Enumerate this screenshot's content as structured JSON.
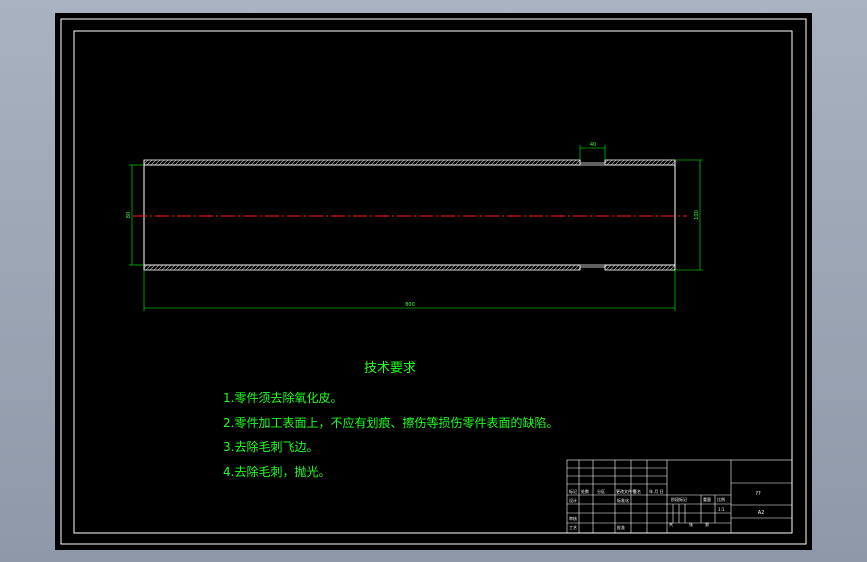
{
  "colors": {
    "background": "#000000",
    "window": "#9aa3b2",
    "outline": "#ffffff",
    "dimension": "#00ff00",
    "centerline": "#ff2020",
    "notes": "#1eff1e"
  },
  "drawing": {
    "dim_top_width": "40",
    "dim_left_diameter": "80",
    "dim_right_diameter": "100",
    "dim_overall_length": "800"
  },
  "notes": {
    "title": "技术要求",
    "items": [
      "1.零件须去除氧化皮。",
      "2.零件加工表面上，不应有划痕、擦伤等损伤零件表面的缺陷。",
      "3.去除毛刺飞边。",
      "4.去除毛刺，抛光。"
    ]
  },
  "title_block": {
    "part_name": "??",
    "sheet_size": "A2",
    "scale": "1:1",
    "labels": [
      "标记",
      "处数",
      "分区",
      "更改文件号",
      "签名",
      "年 月 日",
      "设计",
      "标准化",
      "审核",
      "工艺",
      "批准",
      "阶段标记",
      "重量",
      "比例",
      "共",
      "张",
      "第"
    ]
  }
}
